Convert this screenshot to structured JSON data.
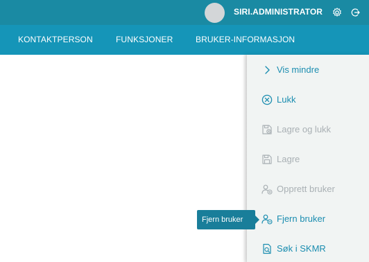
{
  "header": {
    "username": "SIRI.ADMINISTRATOR",
    "icons": [
      "avatar",
      "gear-icon",
      "logout-icon"
    ]
  },
  "nav": {
    "tabs": [
      {
        "label": "KONTAKTPERSON"
      },
      {
        "label": "FUNKSJONER"
      },
      {
        "label": "BRUKER-INFORMASJON"
      }
    ]
  },
  "side_menu": {
    "items": [
      {
        "label": "Vis mindre",
        "icon": "chevron-right-icon",
        "enabled": true
      },
      {
        "label": "Lukk",
        "icon": "close-circle-icon",
        "enabled": true
      },
      {
        "label": "Lagre og lukk",
        "icon": "save-and-close-icon",
        "enabled": false
      },
      {
        "label": "Lagre",
        "icon": "save-icon",
        "enabled": false
      },
      {
        "label": "Opprett bruker",
        "icon": "add-user-icon",
        "enabled": false
      },
      {
        "label": "Fjern bruker",
        "icon": "remove-user-icon",
        "enabled": true
      },
      {
        "label": "Søk i SKMR",
        "icon": "search-document-icon",
        "enabled": true
      }
    ]
  },
  "tooltip": {
    "text": "Fjern bruker"
  },
  "colors": {
    "topbar": "#1a8aa3",
    "navbar": "#1595b8",
    "accent": "#1b8db0",
    "disabled": "#a9b0b4",
    "panel": "#f1f4f3",
    "tooltip": "#197e9a"
  }
}
